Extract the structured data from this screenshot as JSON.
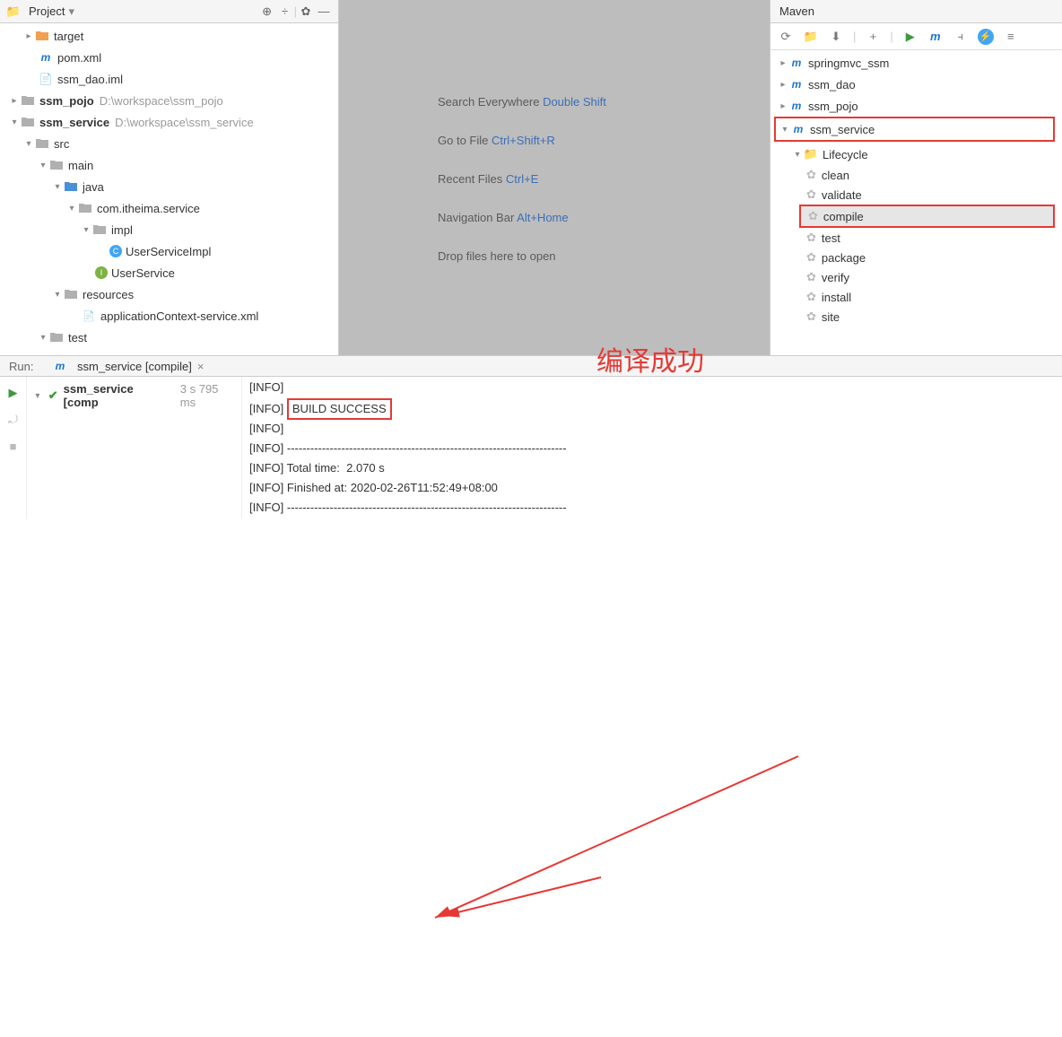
{
  "project_panel": {
    "title": "Project"
  },
  "tree": {
    "target": "target",
    "pom": "pom.xml",
    "dao_iml": "ssm_dao.iml",
    "pojo": "ssm_pojo",
    "pojo_path": "D:\\workspace\\ssm_pojo",
    "service": "ssm_service",
    "service_path": "D:\\workspace\\ssm_service",
    "src": "src",
    "main": "main",
    "java": "java",
    "pkg": "com.itheima.service",
    "impl": "impl",
    "cls": "UserServiceImpl",
    "iface": "UserService",
    "resources": "resources",
    "xml": "applicationContext-service.xml",
    "test": "test"
  },
  "tips": [
    {
      "t": "Search Everywhere ",
      "k": "Double Shift"
    },
    {
      "t": "Go to File ",
      "k": "Ctrl+Shift+R"
    },
    {
      "t": "Recent Files ",
      "k": "Ctrl+E"
    },
    {
      "t": "Navigation Bar ",
      "k": "Alt+Home"
    },
    {
      "t": "Drop files here to open",
      "k": ""
    }
  ],
  "maven": {
    "title": "Maven",
    "projects": [
      "springmvc_ssm",
      "ssm_dao",
      "ssm_pojo",
      "ssm_service"
    ],
    "lifecycle_label": "Lifecycle",
    "goals": [
      "clean",
      "validate",
      "compile",
      "test",
      "package",
      "verify",
      "install",
      "site"
    ]
  },
  "run": {
    "label": "Run:",
    "tab": "ssm_service [compile]",
    "tree_item": "ssm_service [comp",
    "duration": "3 s 795 ms",
    "lines": [
      "[INFO] ",
      "[INFO] ",
      "[INFO] ",
      "[INFO] ------------------------------------------------------------------------",
      "[INFO] Total time:  2.070 s",
      "[INFO] Finished at: 2020-02-26T11:52:49+08:00",
      "[INFO] ------------------------------------------------------------------------"
    ],
    "success": "BUILD SUCCESS"
  },
  "annotation": "编译成功"
}
